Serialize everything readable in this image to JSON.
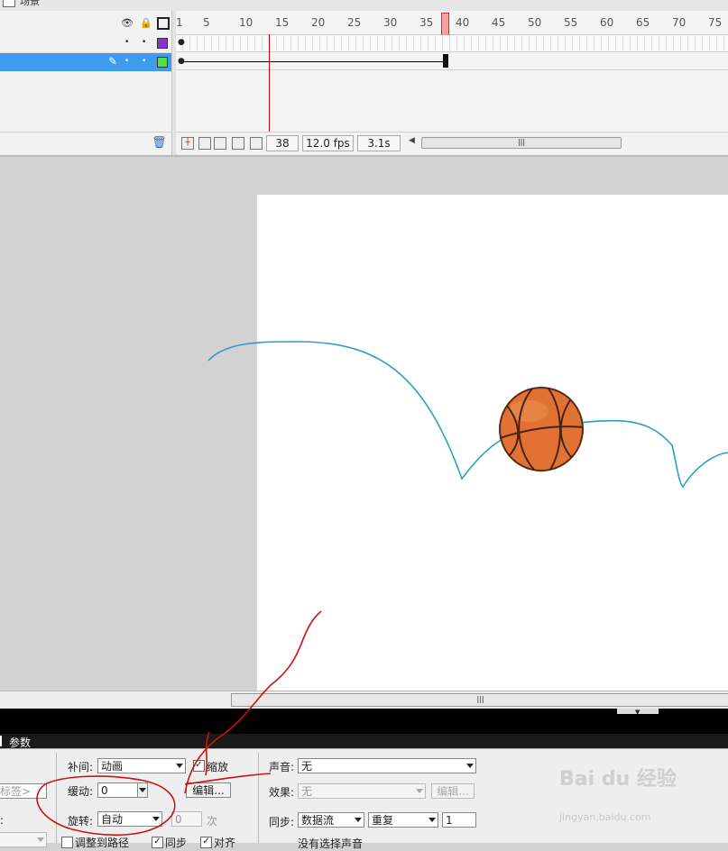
{
  "window": {
    "title": "场景"
  },
  "timeline": {
    "header_icons": {
      "eye": "eye-icon",
      "lock": "lock-icon",
      "outline": "outline-icon"
    },
    "ruler_labels": [
      "1",
      "5",
      "10",
      "15",
      "20",
      "25",
      "30",
      "35",
      "40",
      "45",
      "50",
      "55",
      "60",
      "65",
      "70",
      "75"
    ],
    "layers": [
      {
        "color": "#8a2fd0",
        "selected": false
      },
      {
        "color": "#4fe04f",
        "selected": true
      }
    ],
    "current_frame": "38",
    "frame_rate": "12.0 fps",
    "elapsed": "3.1s"
  },
  "properties": {
    "tab_label": "参数",
    "frame_label_placeholder": "标签>",
    "tween_label": "补间:",
    "tween_value": "动画",
    "scale_label": "缩放",
    "ease_label": "缓动:",
    "ease_value": "0",
    "edit_button": "编辑...",
    "rotate_label": "旋转:",
    "rotate_value": "自动",
    "rotate_count": "0",
    "rotate_unit": "次",
    "orient_label": "调整到路径",
    "sync_label": "同步",
    "snap_label": "对齐",
    "sound_label": "声音:",
    "sound_value": "无",
    "effect_label": "效果:",
    "effect_value": "无",
    "effect_edit_button": "编辑...",
    "sync2_label": "同步:",
    "sync_value": "数据流",
    "repeat_value": "重复",
    "repeat_count": "1",
    "no_sound_text": "没有选择声音"
  },
  "watermark": {
    "logo": "Bai du 经验",
    "url": "jingyan.baidu.com"
  },
  "colors": {
    "selection": "#3d9cf0",
    "motion_path": "#2a9fc8",
    "ball": "#e07030",
    "annotation": "#d01010"
  }
}
